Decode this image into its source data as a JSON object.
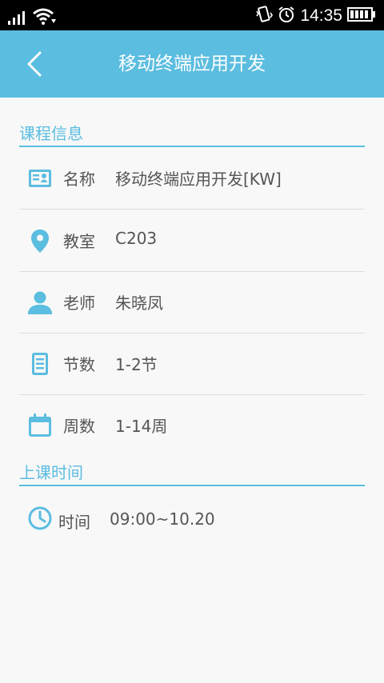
{
  "status_bar": {
    "time": "14:35",
    "icons": [
      "signal-icon",
      "wifi-icon",
      "vibrate-icon",
      "alarm-icon",
      "battery-icon"
    ]
  },
  "app_bar": {
    "title": "移动终端应用开发",
    "back_icon": "chevron-left-icon"
  },
  "course_info": {
    "section_title": "课程信息",
    "rows": [
      {
        "icon": "id-card-icon",
        "label": "名称",
        "value": "移动终端应用开发[KW]"
      },
      {
        "icon": "location-pin-icon",
        "label": "教室",
        "value": "C203"
      },
      {
        "icon": "person-icon",
        "label": "老师",
        "value": "朱晓凤"
      },
      {
        "icon": "document-icon",
        "label": "节数",
        "value": "1-2节"
      },
      {
        "icon": "calendar-icon",
        "label": "周数",
        "value": "1-14周"
      }
    ]
  },
  "class_time": {
    "section_title": "上课时间",
    "rows": [
      {
        "icon": "clock-icon",
        "label": "时间",
        "value": "09:00~10.20"
      }
    ]
  },
  "colors": {
    "accent": "#5bbde0",
    "status_bar": "#000000",
    "background": "#f8f8f8",
    "text": "#555555",
    "divider": "#dcdcdc"
  }
}
